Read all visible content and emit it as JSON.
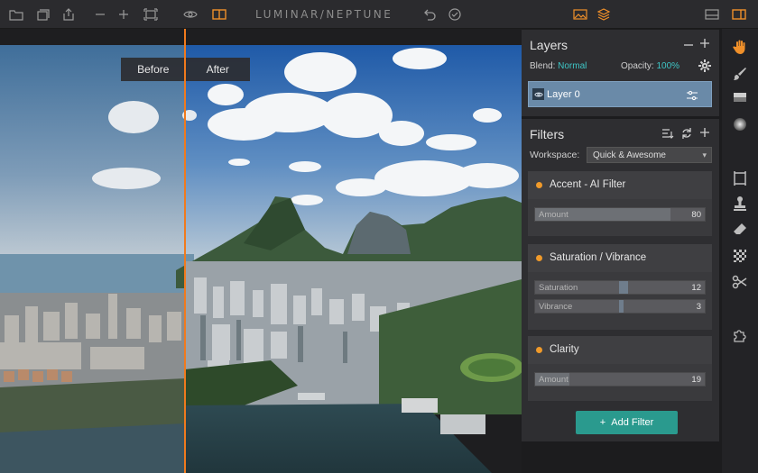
{
  "app": {
    "title": "LUMINAR/NEPTUNE"
  },
  "compare": {
    "before": "Before",
    "after": "After"
  },
  "layers": {
    "title": "Layers",
    "blend_label": "Blend:",
    "blend_value": "Normal",
    "opacity_label": "Opacity:",
    "opacity_value": "100%",
    "layer_name": "Layer 0"
  },
  "filters": {
    "title": "Filters",
    "workspace_label": "Workspace:",
    "workspace_value": "Quick & Awesome",
    "blocks": [
      {
        "name": "Accent - AI Filter",
        "sliders": [
          {
            "label": "Amount",
            "value": "80",
            "fraction": 0.8
          }
        ]
      },
      {
        "name": "Saturation / Vibrance",
        "sliders": [
          {
            "label": "Saturation",
            "value": "12",
            "fraction": 0.56
          },
          {
            "label": "Vibrance",
            "value": "3",
            "fraction": 0.51
          }
        ]
      },
      {
        "name": "Clarity",
        "sliders": [
          {
            "label": "Amount",
            "value": "19",
            "fraction": 0.19
          }
        ]
      }
    ],
    "add_label": "Add Filter"
  },
  "colors": {
    "accent": "#f07a1d",
    "teal": "#2a9a8e",
    "highlight": "#3ec6c6",
    "dot": "#f09a2a"
  }
}
